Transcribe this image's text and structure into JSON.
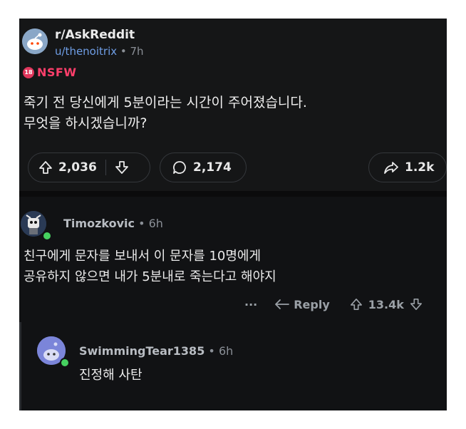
{
  "post": {
    "subreddit": "r/AskReddit",
    "username": "u/thenoitrix",
    "separator": " • ",
    "time": "7h",
    "nsfw_badge": "18",
    "nsfw_label": "NSFW",
    "body_line1": "죽기 전 당신에게 5분이라는 시간이 주어졌습니다.",
    "body_line2": "무엇을 하시겠습니까?",
    "upvotes": "2,036",
    "comments": "2,174",
    "shares": "1.2k"
  },
  "comment1": {
    "author": "Timozkovic",
    "separator": " • ",
    "time": "6h",
    "body_line1": "친구에게 문자를 보내서 이 문자를 10명에게",
    "body_line2": "공유하지 않으면 내가 5분내로 죽는다고 해야지",
    "more": "···",
    "reply_label": "Reply",
    "votes": "13.4k"
  },
  "comment2": {
    "author": "SwimmingTear1385",
    "separator": " • ",
    "time": "6h",
    "body": "진정해 사탄"
  },
  "colors": {
    "background": "#111214",
    "accent_username": "#6f9ee6",
    "nsfw": "#ff3f6b",
    "online": "#46d160"
  },
  "icons": [
    "reddit-snoo-icon",
    "nsfw-18-icon",
    "upvote-arrow-icon",
    "downvote-arrow-icon",
    "comment-bubble-icon",
    "share-arrow-icon",
    "reply-arrow-icon",
    "more-dots-icon"
  ]
}
